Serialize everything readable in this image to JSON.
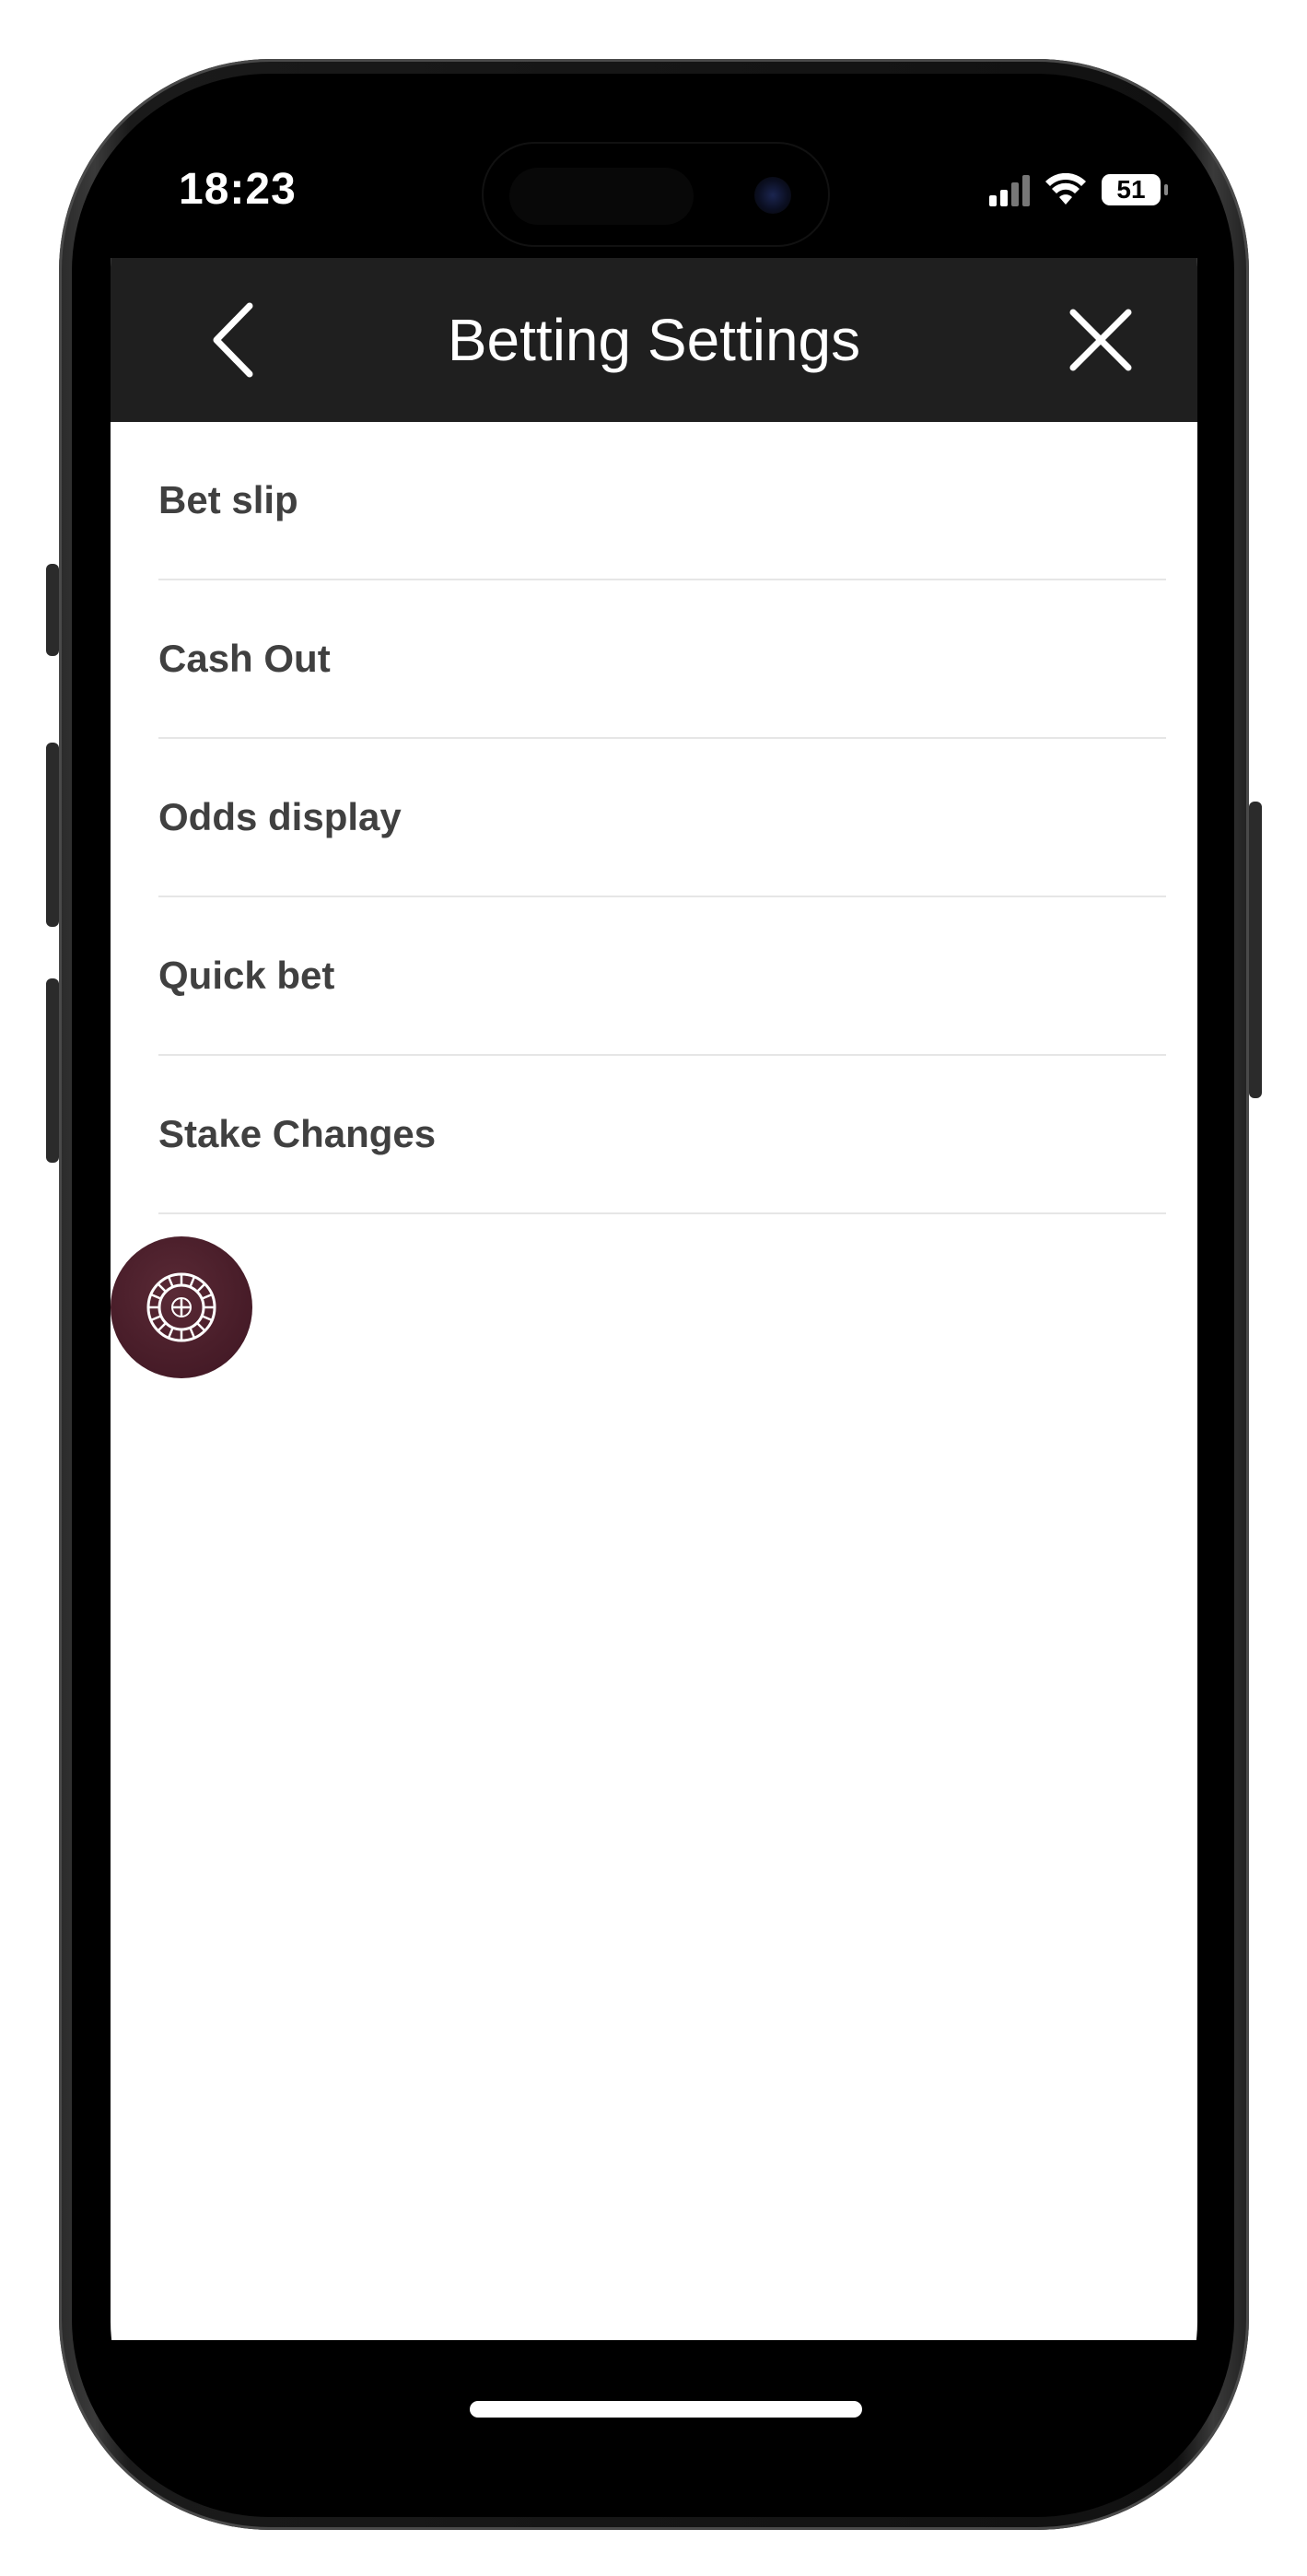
{
  "status_bar": {
    "time": "18:23",
    "battery": "51"
  },
  "header": {
    "title": "Betting Settings",
    "back_icon": "chevron-left-icon",
    "close_icon": "close-icon"
  },
  "settings": {
    "items": [
      {
        "label": "Bet slip"
      },
      {
        "label": "Cash Out"
      },
      {
        "label": "Odds display"
      },
      {
        "label": "Quick bet"
      },
      {
        "label": "Stake Changes"
      }
    ]
  },
  "fab": {
    "icon": "roulette-wheel-icon",
    "color": "#4a1e2a"
  },
  "colors": {
    "header_bg": "#1f1f1f",
    "list_text": "#404040",
    "divider": "#e6e6e6"
  }
}
